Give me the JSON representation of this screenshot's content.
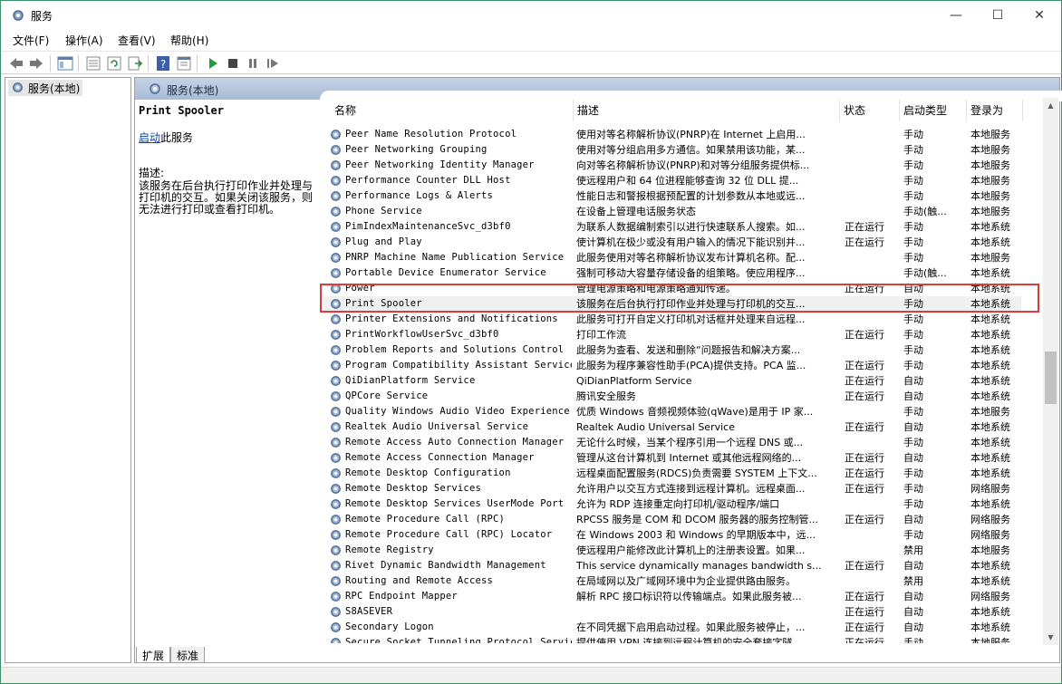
{
  "window": {
    "title": "服务",
    "minimize": "—",
    "maximize": "☐",
    "close": "✕"
  },
  "menu": [
    "文件(F)",
    "操作(A)",
    "查看(V)",
    "帮助(H)"
  ],
  "tree": {
    "item": "服务(本地)"
  },
  "pane": {
    "header": "服务(本地)"
  },
  "detail": {
    "service_name": "Print Spooler",
    "start_link": "启动",
    "start_suffix": "此服务",
    "desc_label": "描述:",
    "desc_text": "该服务在后台执行打印作业并处理与打印机的交互。如果关闭该服务，则无法进行打印或查看打印机。"
  },
  "columns": {
    "name": "名称",
    "desc": "描述",
    "status": "状态",
    "start": "启动类型",
    "logon": "登录为"
  },
  "rows": [
    {
      "name": "Peer Name Resolution Protocol",
      "desc": "使用对等名称解析协议(PNRP)在 Internet 上启用...",
      "status": "",
      "start": "手动",
      "logon": "本地服务"
    },
    {
      "name": "Peer Networking Grouping",
      "desc": "使用对等分组启用多方通信。如果禁用该功能，某...",
      "status": "",
      "start": "手动",
      "logon": "本地服务"
    },
    {
      "name": "Peer Networking Identity Manager",
      "desc": "向对等名称解析协议(PNRP)和对等分组服务提供标...",
      "status": "",
      "start": "手动",
      "logon": "本地服务"
    },
    {
      "name": "Performance Counter DLL Host",
      "desc": "使远程用户和 64 位进程能够查询 32 位 DLL 提...",
      "status": "",
      "start": "手动",
      "logon": "本地服务"
    },
    {
      "name": "Performance Logs & Alerts",
      "desc": "性能日志和警报根据预配置的计划参数从本地或远...",
      "status": "",
      "start": "手动",
      "logon": "本地服务"
    },
    {
      "name": "Phone Service",
      "desc": "在设备上管理电话服务状态",
      "status": "",
      "start": "手动(触...",
      "logon": "本地服务"
    },
    {
      "name": "PimIndexMaintenanceSvc_d3bf0",
      "desc": "为联系人数据编制索引以进行快速联系人搜索。如...",
      "status": "正在运行",
      "start": "手动",
      "logon": "本地系统"
    },
    {
      "name": "Plug and Play",
      "desc": "使计算机在极少或没有用户输入的情况下能识别并...",
      "status": "正在运行",
      "start": "手动",
      "logon": "本地系统"
    },
    {
      "name": "PNRP Machine Name Publication Service",
      "desc": "此服务使用对等名称解析协议发布计算机名称。配...",
      "status": "",
      "start": "手动",
      "logon": "本地服务"
    },
    {
      "name": "Portable Device Enumerator Service",
      "desc": "强制可移动大容量存储设备的组策略。使应用程序...",
      "status": "",
      "start": "手动(触...",
      "logon": "本地系统"
    },
    {
      "name": "Power",
      "desc": "管理电源策略和电源策略通知传递。",
      "status": "正在运行",
      "start": "自动",
      "logon": "本地系统"
    },
    {
      "name": "Print Spooler",
      "desc": "该服务在后台执行打印作业并处理与打印机的交互...",
      "status": "",
      "start": "手动",
      "logon": "本地系统"
    },
    {
      "name": "Printer Extensions and Notifications",
      "desc": "此服务可打开自定义打印机对话框并处理来自远程...",
      "status": "",
      "start": "手动",
      "logon": "本地系统"
    },
    {
      "name": "PrintWorkflowUserSvc_d3bf0",
      "desc": "打印工作流",
      "status": "正在运行",
      "start": "手动",
      "logon": "本地系统"
    },
    {
      "name": "Problem Reports and Solutions Control ...",
      "desc": "此服务为查看、发送和删除“问题报告和解决方案...",
      "status": "",
      "start": "手动",
      "logon": "本地系统"
    },
    {
      "name": "Program Compatibility Assistant Service",
      "desc": "此服务为程序兼容性助手(PCA)提供支持。PCA 监...",
      "status": "正在运行",
      "start": "手动",
      "logon": "本地系统"
    },
    {
      "name": "QiDianPlatform Service",
      "desc": "QiDianPlatform Service",
      "status": "正在运行",
      "start": "自动",
      "logon": "本地系统"
    },
    {
      "name": "QPCore Service",
      "desc": "腾讯安全服务",
      "status": "正在运行",
      "start": "自动",
      "logon": "本地系统"
    },
    {
      "name": "Quality Windows Audio Video Experience",
      "desc": "优质 Windows 音频视频体验(qWave)是用于 IP 家...",
      "status": "",
      "start": "手动",
      "logon": "本地服务"
    },
    {
      "name": "Realtek Audio Universal Service",
      "desc": "Realtek Audio Universal Service",
      "status": "正在运行",
      "start": "自动",
      "logon": "本地系统"
    },
    {
      "name": "Remote Access Auto Connection Manager",
      "desc": "无论什么时候，当某个程序引用一个远程 DNS 或...",
      "status": "",
      "start": "手动",
      "logon": "本地系统"
    },
    {
      "name": "Remote Access Connection Manager",
      "desc": "管理从这台计算机到 Internet 或其他远程网络的...",
      "status": "正在运行",
      "start": "自动",
      "logon": "本地系统"
    },
    {
      "name": "Remote Desktop Configuration",
      "desc": "远程桌面配置服务(RDCS)负责需要 SYSTEM 上下文...",
      "status": "正在运行",
      "start": "手动",
      "logon": "本地系统"
    },
    {
      "name": "Remote Desktop Services",
      "desc": "允许用户以交互方式连接到远程计算机。远程桌面...",
      "status": "正在运行",
      "start": "手动",
      "logon": "网络服务"
    },
    {
      "name": "Remote Desktop Services UserMode Port ...",
      "desc": "允许为 RDP 连接重定向打印机/驱动程序/端口",
      "status": "",
      "start": "手动",
      "logon": "本地系统"
    },
    {
      "name": "Remote Procedure Call (RPC)",
      "desc": "RPCSS 服务是 COM 和 DCOM 服务器的服务控制管...",
      "status": "正在运行",
      "start": "自动",
      "logon": "网络服务"
    },
    {
      "name": "Remote Procedure Call (RPC) Locator",
      "desc": "在 Windows 2003 和 Windows 的早期版本中，远...",
      "status": "",
      "start": "手动",
      "logon": "网络服务"
    },
    {
      "name": "Remote Registry",
      "desc": "使远程用户能修改此计算机上的注册表设置。如果...",
      "status": "",
      "start": "禁用",
      "logon": "本地服务"
    },
    {
      "name": "Rivet Dynamic Bandwidth Management",
      "desc": "This service dynamically manages bandwidth s...",
      "status": "正在运行",
      "start": "自动",
      "logon": "本地系统"
    },
    {
      "name": "Routing and Remote Access",
      "desc": "在局域网以及广域网环境中为企业提供路由服务。",
      "status": "",
      "start": "禁用",
      "logon": "本地系统"
    },
    {
      "name": "RPC Endpoint Mapper",
      "desc": "解析 RPC 接口标识符以传输端点。如果此服务被...",
      "status": "正在运行",
      "start": "自动",
      "logon": "网络服务"
    },
    {
      "name": "S8ASEVER",
      "desc": "",
      "status": "正在运行",
      "start": "自动",
      "logon": "本地系统"
    },
    {
      "name": "Secondary Logon",
      "desc": "在不同凭据下启用启动过程。如果此服务被停止，...",
      "status": "正在运行",
      "start": "自动",
      "logon": "本地系统"
    },
    {
      "name": "Secure Socket Tunneling Protocol Service",
      "desc": "提供使用 VPN 连接到远程计算机的安全套接字隧...",
      "status": "正在运行",
      "start": "手动",
      "logon": "本地服务"
    }
  ],
  "selected_row": "Print Spooler",
  "bottom_tabs": [
    "扩展",
    "标准"
  ],
  "colors": {
    "header_gradient_top": "#c5d3e6",
    "header_gradient_bottom": "#a9bbd6",
    "highlight_border": "#e03a3a",
    "link": "#0645ad"
  },
  "scroll": {
    "thumb_position_fraction": 0.48
  }
}
